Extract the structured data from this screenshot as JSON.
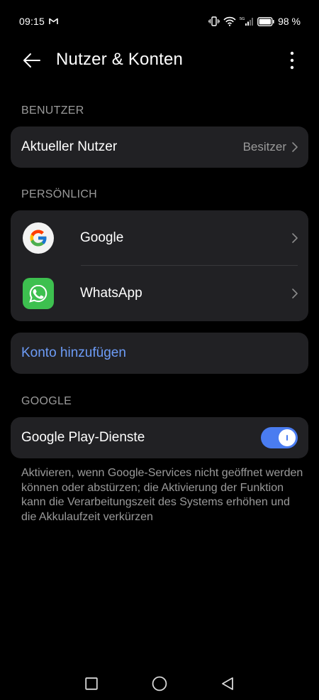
{
  "status_bar": {
    "time": "09:15",
    "battery": "98 %"
  },
  "app_bar": {
    "title": "Nutzer & Konten"
  },
  "sections": {
    "users": {
      "header": "BENUTZER",
      "current_user_label": "Aktueller Nutzer",
      "current_user_value": "Besitzer"
    },
    "personal": {
      "header": "PERSÖNLICH",
      "accounts": [
        {
          "label": "Google",
          "icon": "google-icon"
        },
        {
          "label": "WhatsApp",
          "icon": "whatsapp-icon"
        }
      ],
      "add_account_label": "Konto hinzufügen"
    },
    "google": {
      "header": "GOOGLE",
      "play_services_label": "Google Play-Dienste",
      "play_services_enabled": true,
      "description": "Aktivieren, wenn Google-Services nicht geöffnet werden können oder abstürzen; die Aktivierung der Funktion kann die Verarbeitungszeit des Systems erhöhen und die Akkulaufzeit verkürzen"
    }
  },
  "colors": {
    "background": "#000000",
    "card": "#212124",
    "accent": "#4a7cf0",
    "link": "#6d9cf7",
    "secondary_text": "#9a9a9a"
  }
}
